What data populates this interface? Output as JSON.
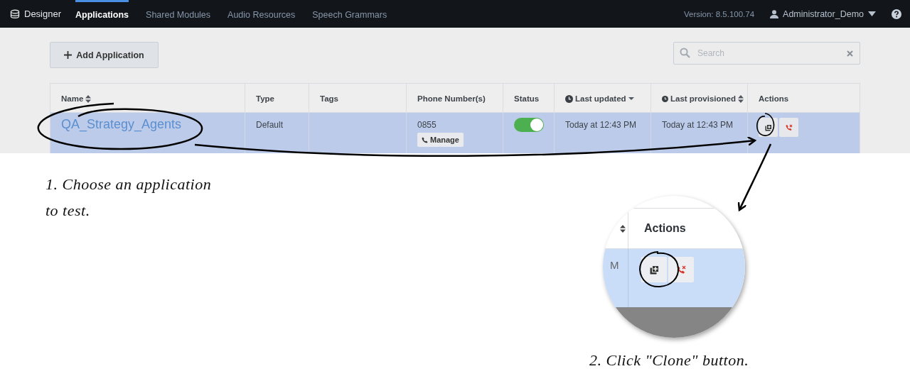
{
  "nav": {
    "brand": "Designer",
    "tabs": [
      {
        "label": "Applications",
        "selected": true
      },
      {
        "label": "Shared Modules",
        "selected": false
      },
      {
        "label": "Audio Resources",
        "selected": false
      },
      {
        "label": "Speech Grammars",
        "selected": false
      }
    ],
    "version": "Version: 8.5.100.74",
    "user": "Administrator_Demo"
  },
  "toolbar": {
    "add_button": "Add Application",
    "search": {
      "placeholder": "Search"
    }
  },
  "table": {
    "columns": [
      {
        "label": "Name",
        "kind": "sortable"
      },
      {
        "label": "Type",
        "kind": "plain"
      },
      {
        "label": "Tags",
        "kind": "plain"
      },
      {
        "label": "Phone Number(s)",
        "kind": "plain"
      },
      {
        "label": "Status",
        "kind": "plain"
      },
      {
        "label": "Last updated",
        "kind": "datesorted"
      },
      {
        "label": "Last provisioned",
        "kind": "datesortable"
      },
      {
        "label": "Actions",
        "kind": "plain"
      }
    ],
    "rows": [
      {
        "selected": true,
        "name": "QA_Strategy_Agents",
        "type": "Default",
        "phone": "0855",
        "manage_button": "Manage",
        "status_on": true,
        "last_updated": "Today at 12:43 PM",
        "last_provisioned": "Today at 12:43 PM"
      }
    ]
  },
  "magnifier": {
    "header": "Actions",
    "cell_text": "M"
  },
  "annotations": [
    {
      "text": "1. Choose an application to test."
    },
    {
      "text": "2. Click \"Clone\" button."
    }
  ]
}
